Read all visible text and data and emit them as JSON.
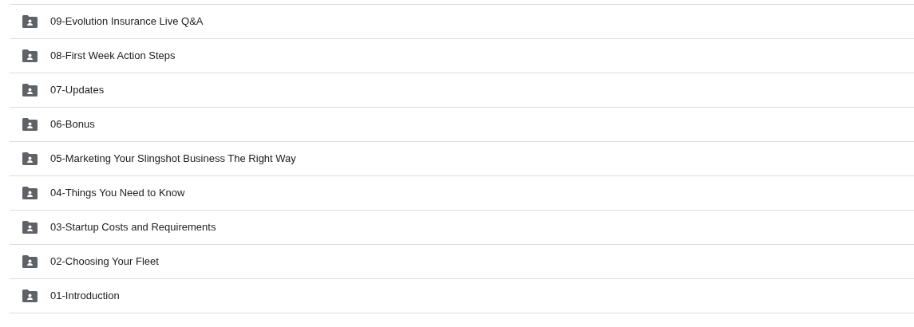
{
  "folders": [
    {
      "name": "09-Evolution Insurance Live Q&A"
    },
    {
      "name": "08-First Week Action Steps"
    },
    {
      "name": "07-Updates"
    },
    {
      "name": "06-Bonus"
    },
    {
      "name": "05-Marketing Your Slingshot Business The Right Way"
    },
    {
      "name": "04-Things You Need to Know"
    },
    {
      "name": "03-Startup Costs and Requirements"
    },
    {
      "name": "02-Choosing Your Fleet"
    },
    {
      "name": "01-Introduction"
    }
  ]
}
